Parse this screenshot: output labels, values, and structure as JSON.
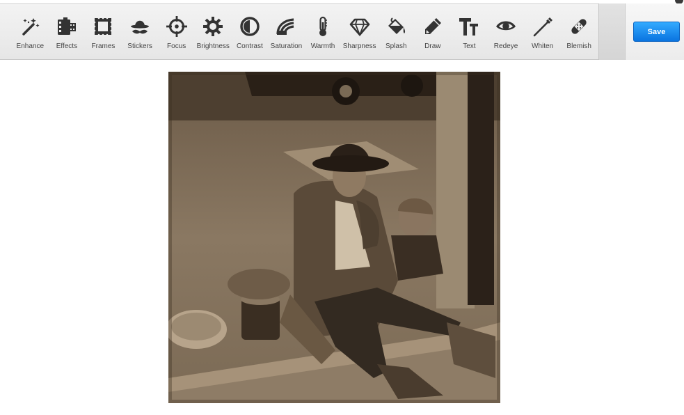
{
  "toolbar": {
    "tools": [
      {
        "label": "Enhance",
        "icon": "magic-wand-icon"
      },
      {
        "label": "Effects",
        "icon": "film-icon"
      },
      {
        "label": "Frames",
        "icon": "frame-icon"
      },
      {
        "label": "Stickers",
        "icon": "hat-mustache-icon"
      },
      {
        "label": "Focus",
        "icon": "crosshair-icon"
      },
      {
        "label": "Brightness",
        "icon": "sun-icon"
      },
      {
        "label": "Contrast",
        "icon": "contrast-icon"
      },
      {
        "label": "Saturation",
        "icon": "saturation-icon"
      },
      {
        "label": "Warmth",
        "icon": "thermometer-icon"
      },
      {
        "label": "Sharpness",
        "icon": "diamond-icon"
      },
      {
        "label": "Splash",
        "icon": "paint-bucket-icon"
      },
      {
        "label": "Draw",
        "icon": "pencil-icon"
      },
      {
        "label": "Text",
        "icon": "text-icon"
      },
      {
        "label": "Redeye",
        "icon": "eye-icon"
      },
      {
        "label": "Whiten",
        "icon": "toothbrush-icon"
      },
      {
        "label": "Blemish",
        "icon": "bandage-icon"
      }
    ],
    "save_label": "Save"
  },
  "colors": {
    "accent": "#1a8cf0",
    "icon": "#333333",
    "sepia_dark": "#2f241a",
    "sepia_light": "#b9a58a"
  }
}
